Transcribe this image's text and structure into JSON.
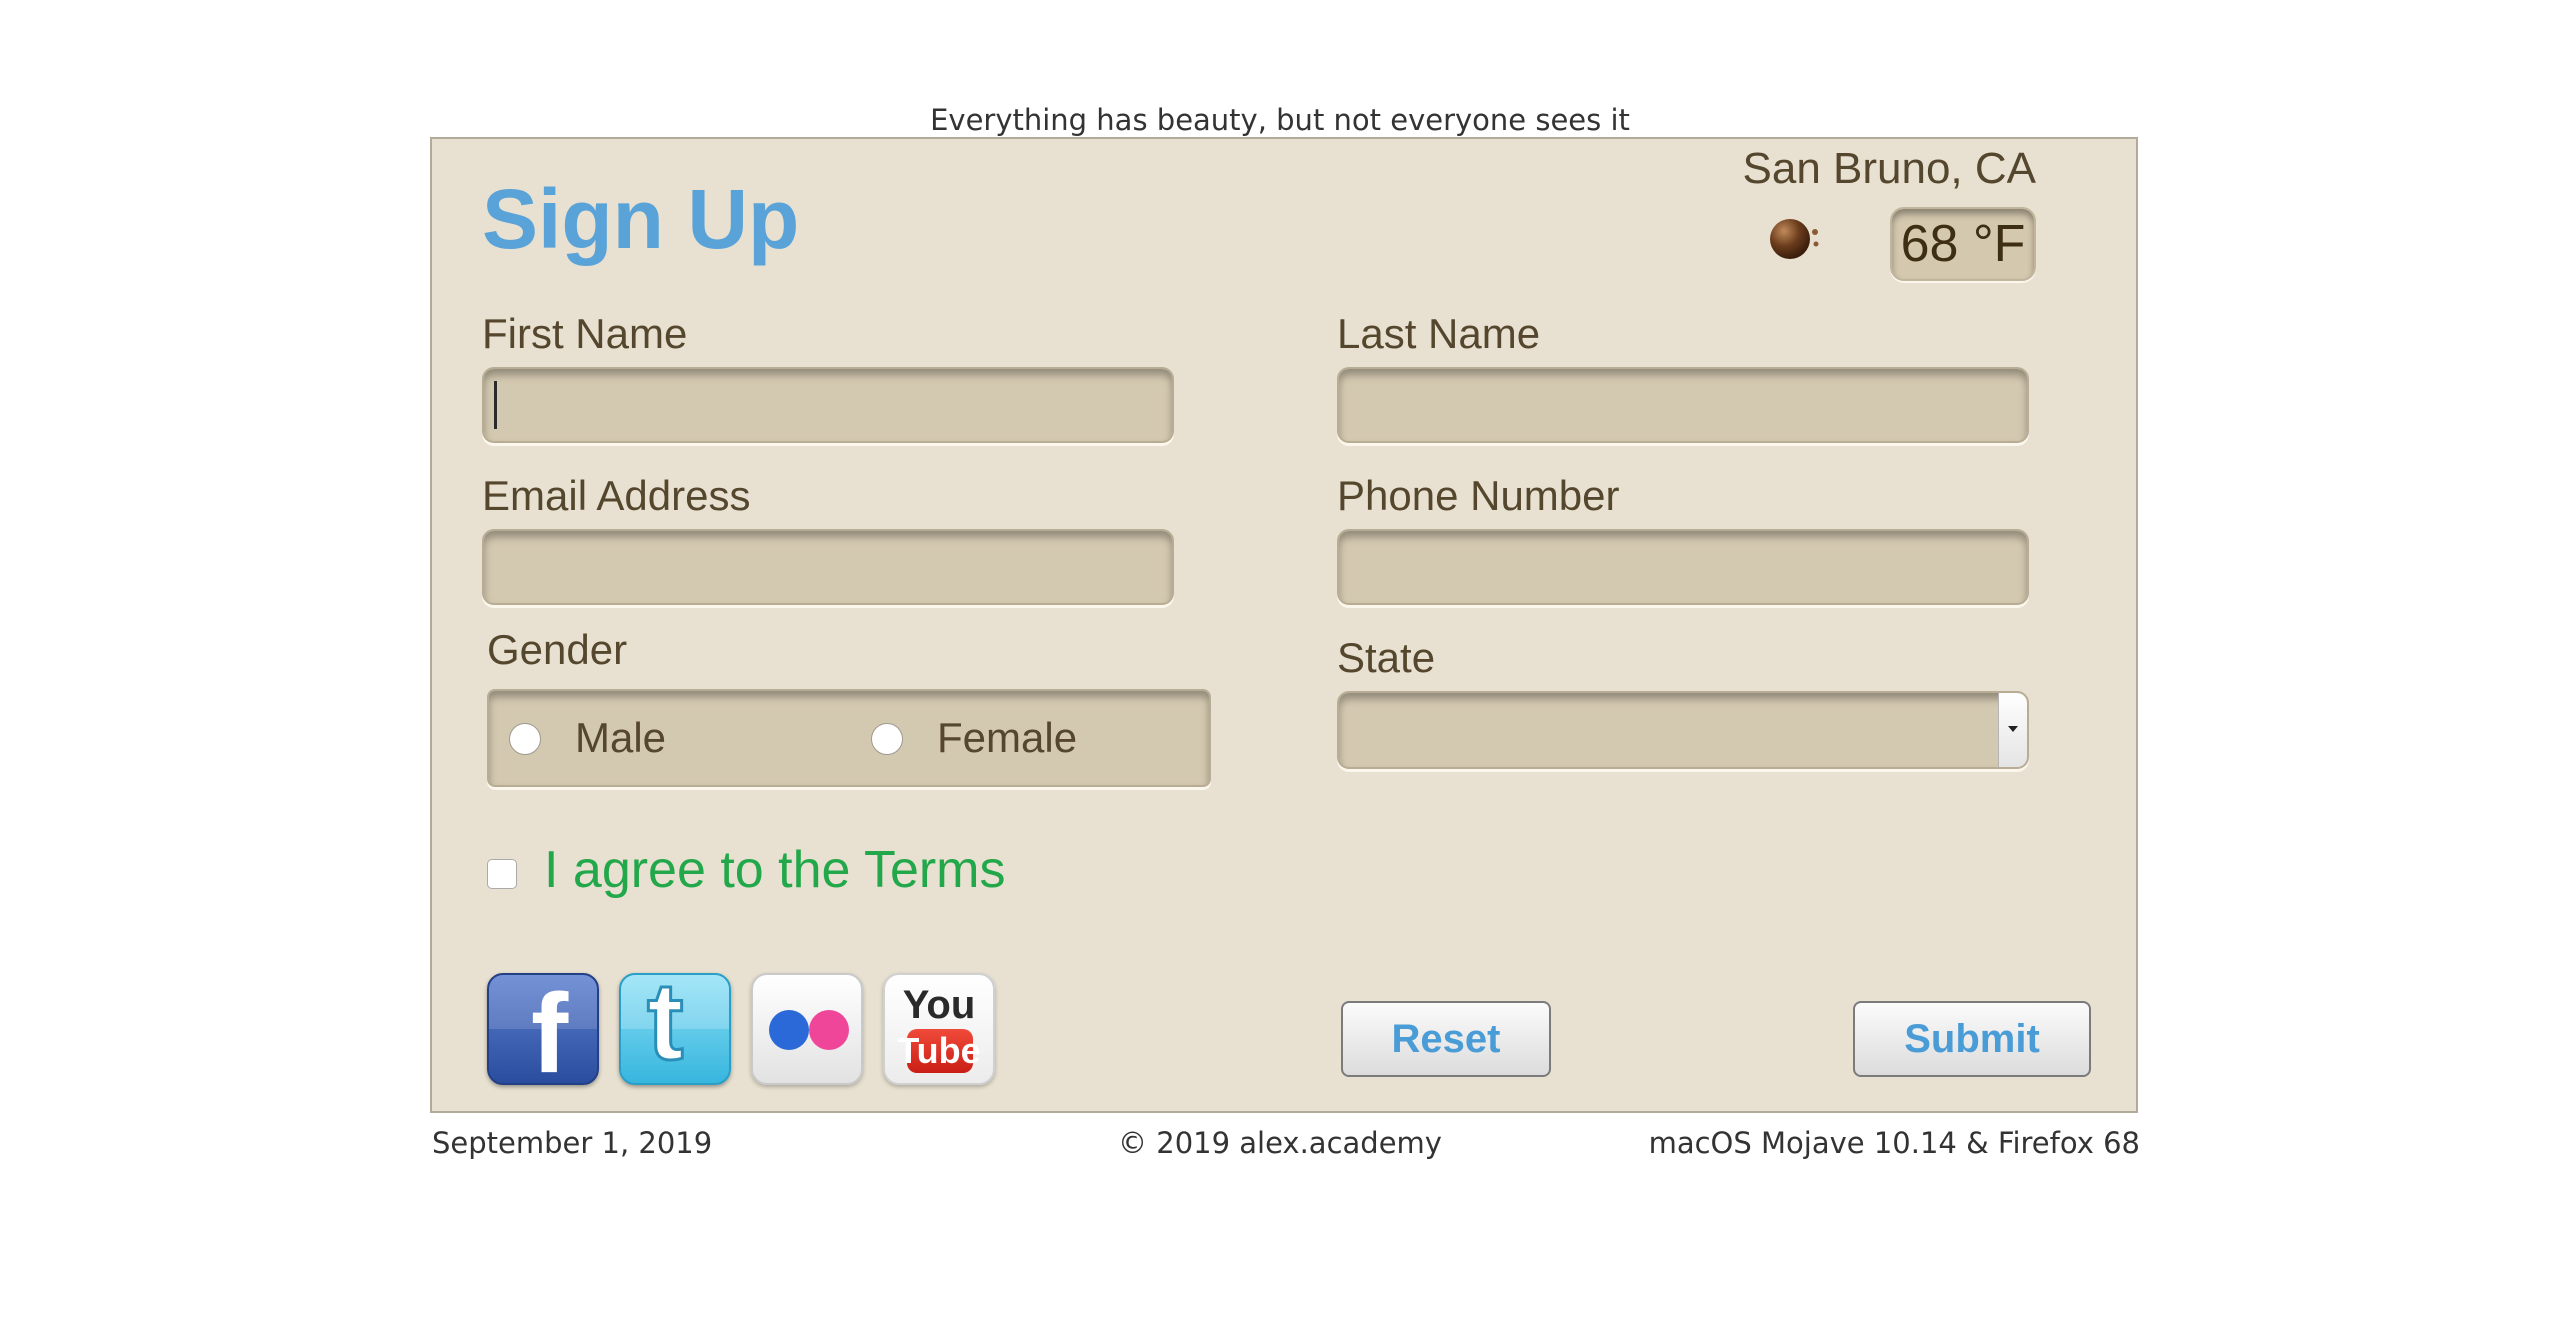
{
  "tagline": "Everything has beauty, but not everyone sees it",
  "header": {
    "title": "Sign Up",
    "location": "San Bruno, CA",
    "temperature": "68 °F",
    "weather_icon": "weather-icon"
  },
  "form": {
    "first_name": {
      "label": "First Name",
      "value": ""
    },
    "last_name": {
      "label": "Last Name",
      "value": ""
    },
    "email": {
      "label": "Email Address",
      "value": ""
    },
    "phone": {
      "label": "Phone Number",
      "value": ""
    },
    "gender": {
      "label": "Gender",
      "options": [
        "Male",
        "Female"
      ]
    },
    "state": {
      "label": "State",
      "selected": ""
    },
    "terms_label": "I agree to the Terms",
    "terms_checked": false
  },
  "social": [
    {
      "name": "facebook-icon",
      "text": "f"
    },
    {
      "name": "twitter-icon",
      "text": "t"
    },
    {
      "name": "flickr-icon"
    },
    {
      "name": "youtube-icon",
      "top": "You",
      "bottom": "Tube"
    }
  ],
  "buttons": {
    "reset": "Reset",
    "submit": "Submit"
  },
  "footer": {
    "date": "September 1, 2019",
    "copyright": "© 2019 alex.academy",
    "platform": "macOS Mojave 10.14 & Firefox 68"
  },
  "colors": {
    "panel_bg": "#e8e1d1",
    "title": "#5aa3d8",
    "terms": "#22a84a",
    "field_bg": "#d3c8b0"
  }
}
